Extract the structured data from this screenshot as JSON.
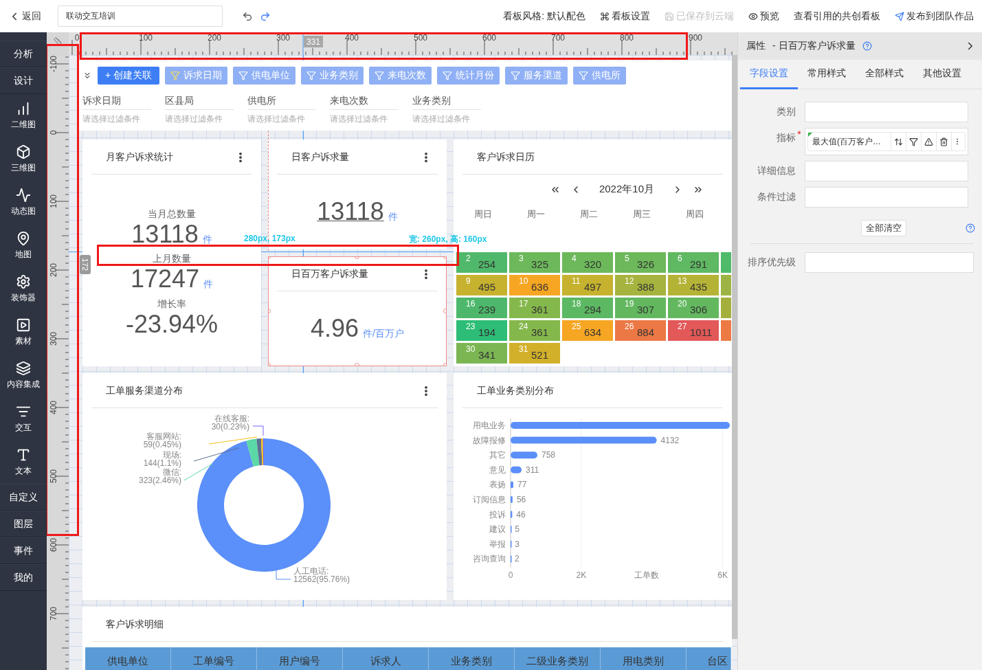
{
  "topbar": {
    "back": "返回",
    "title_field": "联动交互培训",
    "actions": [
      {
        "label": "看板风格: 默认配色",
        "disabled": false
      },
      {
        "label": "看板设置",
        "disabled": false
      },
      {
        "label": "已保存到云端",
        "disabled": true
      },
      {
        "label": "预览",
        "disabled": false
      },
      {
        "label": "查看引用的共创看板",
        "disabled": false
      },
      {
        "label": "发布到团队作品",
        "disabled": false
      }
    ]
  },
  "sidebar": {
    "items": [
      {
        "label": "分析",
        "kind": "section"
      },
      {
        "label": "设计",
        "kind": "section"
      },
      {
        "label": "二维图",
        "kind": "tool"
      },
      {
        "label": "三维图",
        "kind": "tool"
      },
      {
        "label": "动态图",
        "kind": "tool"
      },
      {
        "label": "地图",
        "kind": "tool"
      },
      {
        "label": "装饰器",
        "kind": "tool"
      },
      {
        "label": "素材",
        "kind": "tool"
      },
      {
        "label": "内容集成",
        "kind": "tool"
      },
      {
        "label": "交互",
        "kind": "tool"
      },
      {
        "label": "文本",
        "kind": "tool"
      },
      {
        "label": "自定义",
        "kind": "section"
      },
      {
        "label": "图层",
        "kind": "section"
      },
      {
        "label": "事件",
        "kind": "section"
      },
      {
        "label": "我的",
        "kind": "section"
      }
    ]
  },
  "canvas": {
    "ruler_top": {
      "labels": [
        "0",
        "100",
        "200",
        "300",
        "400",
        "500",
        "600",
        "700",
        "800",
        "900"
      ],
      "marker": "331"
    },
    "ruler_left": {
      "labels": [
        "-100",
        "0",
        "100",
        "200",
        "300",
        "400",
        "500",
        "600",
        "700"
      ],
      "marker": "172"
    },
    "guides": {
      "position": "280px, 173px",
      "size": "宽: 260px, 高: 160px"
    }
  },
  "filter_bar": {
    "create_button": "+ 创建关联",
    "filters": [
      {
        "label": "诉求日期",
        "highlighted": true
      },
      {
        "label": "供电单位",
        "highlighted": false
      },
      {
        "label": "业务类别",
        "highlighted": false
      },
      {
        "label": "来电次数",
        "highlighted": false
      },
      {
        "label": "统计月份",
        "highlighted": false
      },
      {
        "label": "服务渠道",
        "highlighted": false
      },
      {
        "label": "供电所",
        "highlighted": false
      }
    ],
    "fields": [
      {
        "label": "诉求日期",
        "placeholder": "请选择过滤条件"
      },
      {
        "label": "区县局",
        "placeholder": "请选择过滤条件"
      },
      {
        "label": "供电所",
        "placeholder": "请选择过滤条件"
      },
      {
        "label": "来电次数",
        "placeholder": "请选择过滤条件"
      },
      {
        "label": "业务类别",
        "placeholder": "请选择过滤条件"
      }
    ]
  },
  "month_stats": {
    "title": "月客户诉求统计",
    "has_menu": true,
    "stats": [
      {
        "label": "当月总数量",
        "value": "13118",
        "unit": "件"
      },
      {
        "label": "上月数量",
        "value": "17247",
        "unit": "件"
      },
      {
        "label": "增长率",
        "value": "-23.94%"
      }
    ]
  },
  "daily_card": {
    "title": "日客户诉求量",
    "has_menu": true,
    "value": "13118",
    "unit": "件",
    "selected": false
  },
  "million_card": {
    "title": "日百万客户诉求量",
    "has_menu": true,
    "value": "4.96",
    "unit": "件/百万户",
    "selected": true
  },
  "calendar": {
    "title": "客户诉求日历",
    "has_menu": false,
    "month": "2022年10月",
    "weekdays": [
      "周日",
      "周一",
      "周二",
      "周三",
      "周四"
    ],
    "weeks": [
      [
        {
          "day": "2",
          "value": "254",
          "color": "#50b86a"
        },
        {
          "day": "3",
          "value": "325",
          "color": "#6cb85a"
        },
        {
          "day": "4",
          "value": "320",
          "color": "#6cb85a"
        },
        {
          "day": "5",
          "value": "326",
          "color": "#6cb85a"
        },
        {
          "day": "6",
          "value": "291",
          "color": "#5fb862"
        },
        {
          "color": "#4fba6a"
        }
      ],
      [
        {
          "day": "9",
          "value": "495",
          "color": "#c6b22f"
        },
        {
          "day": "10",
          "value": "636",
          "color": "#f6a623"
        },
        {
          "day": "11",
          "value": "497",
          "color": "#c6b22f"
        },
        {
          "day": "12",
          "value": "388",
          "color": "#a6b33e"
        },
        {
          "day": "13",
          "value": "435",
          "color": "#b5b336"
        },
        {
          "color": "#9cb443"
        }
      ],
      [
        {
          "day": "16",
          "value": "239",
          "color": "#4db86b"
        },
        {
          "day": "17",
          "value": "361",
          "color": "#85b84c"
        },
        {
          "day": "18",
          "value": "294",
          "color": "#5cb862"
        },
        {
          "day": "19",
          "value": "307",
          "color": "#63b85f"
        },
        {
          "day": "20",
          "value": "306",
          "color": "#63b85f"
        },
        {
          "color": "#a5b03c"
        }
      ],
      [
        {
          "day": "23",
          "value": "194",
          "color": "#2dbd76"
        },
        {
          "day": "24",
          "value": "361",
          "color": "#85b84c"
        },
        {
          "day": "25",
          "value": "634",
          "color": "#f6a623"
        },
        {
          "day": "26",
          "value": "884",
          "color": "#ec7845"
        },
        {
          "day": "27",
          "value": "1011",
          "color": "#e35858"
        },
        {
          "color": "#ed7a44"
        }
      ],
      [
        {
          "day": "30",
          "value": "341",
          "color": "#7bb653"
        },
        {
          "day": "31",
          "value": "521",
          "color": "#d3b02a"
        }
      ]
    ]
  },
  "channel_chart": {
    "title": "工单服务渠道分布",
    "has_menu": true,
    "chart_data": {
      "type": "donut",
      "series": [
        {
          "values": [
            95.76,
            2.46,
            1.1,
            0.45,
            0.23
          ]
        }
      ],
      "colors": [
        "#5b8ff9",
        "#5ad8a6",
        "#5d7092",
        "#f6bd16",
        "#7262fd"
      ],
      "value_labels": [
        {
          "name": "人工电话:",
          "text": "12562(95.76%)"
        },
        {
          "name": "微信:",
          "text": "323(2.46%)"
        },
        {
          "name": "现场:",
          "text": "144(1.1%)"
        },
        {
          "name": "客服网站:",
          "text": "59(0.45%)"
        },
        {
          "name": "在线客服:",
          "text": "30(0.23%)"
        }
      ]
    }
  },
  "category_chart": {
    "title": "工单业务类别分布",
    "has_menu": false,
    "chart_data": {
      "type": "bar",
      "orientation": "horizontal",
      "xlabel": "工单数",
      "categories": [
        "用电业务",
        "故障报修",
        "其它",
        "意见",
        "表扬",
        "订阅信息",
        "投诉",
        "建议",
        "举报",
        "咨询查询"
      ],
      "series": [
        {
          "color": "#5b8ff9",
          "values": [
            6200,
            4132,
            758,
            311,
            77,
            56,
            46,
            5,
            3,
            2
          ]
        }
      ],
      "xlim": [
        0,
        6200
      ],
      "xticks": [
        0,
        {
          "value": 2000,
          "label": "2K"
        },
        {
          "value": 6000,
          "label": "6K"
        }
      ],
      "value_labels": [
        null,
        "4132",
        "758",
        "311",
        "77",
        "56",
        "46",
        "5",
        "3",
        "2"
      ]
    }
  },
  "detail_table": {
    "title": "客户诉求明细",
    "has_menu": false,
    "columns": [
      "供电单位",
      "工单编号",
      "用户编号",
      "诉求人",
      "业务类别",
      "二级业务类别",
      "用电类别",
      "台区"
    ]
  },
  "properties": {
    "title": "属性",
    "subtitle": "- 日百万客户诉求量",
    "tabs": [
      {
        "label": "字段设置",
        "selected": true
      },
      {
        "label": "常用样式",
        "selected": false
      },
      {
        "label": "全部样式",
        "selected": false
      },
      {
        "label": "其他设置",
        "selected": false
      }
    ],
    "fields": [
      {
        "label": "类别",
        "required": false
      },
      {
        "label": "指标",
        "required": true,
        "chip": "最大值(百万客户…"
      },
      {
        "label": "详细信息",
        "required": false
      },
      {
        "label": "条件过滤",
        "required": false
      }
    ],
    "clear_button": "全部清空",
    "sort_label": "排序优先级"
  }
}
